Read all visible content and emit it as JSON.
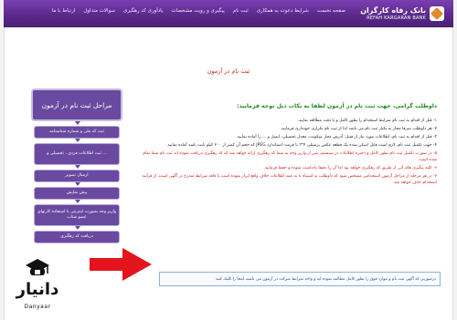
{
  "header": {
    "logo_fa": "بانک رفاه کارگران",
    "logo_en": "REFAH KARGARAN BANK",
    "nav": [
      "صفحه نخست",
      "شرایط دعوت به همکاری",
      "ثبت نام",
      "پیگیری و رویت مشخصات",
      "یادآوری کد رهگیری",
      "سوالات متداول",
      "ارتباط با ما"
    ]
  },
  "page_title": "ثبت نام در آزمون",
  "sidebar": {
    "heading": "مراحل ثبت نام در آزمون",
    "steps": [
      "ثبت کد ملی و شماره شناسنامه",
      "ثبت اطلاعات فردی ، تحصیلی و ...",
      "ارسال تصویر",
      "پیش نمایش",
      "واریز وجه بصورت اینترنتی با استفاده کارتهای عضو شتاب",
      "دریافت کد رهگیری"
    ]
  },
  "content": {
    "intro": "داوطلب گرامی، جهت ثبت نام در آزمون لطفا به نکات ذیل توجه فرمایید:",
    "rules": [
      {
        "text": "۱- قبل از اقدام به ثبت نام شرایط استخدام را بطور کامل و با دقت مطالعه نمایید.",
        "red": false
      },
      {
        "text": "۲- هر داوطلب صرفا مجاز به یکبار ثبت نام می باشد لذا از ثبت نام تکراری خودداری فرمایید.",
        "red": false
      },
      {
        "text": "۳- قبل از اقدام به ثبت نام، اطلاعات مورد نیاز از قبیل: آدرس محل سکونت، معدل تحصیلی، ایمیل و ... را آماده نمایید.",
        "red": false
      },
      {
        "text": "۴- جهت تکمیل ثبت نام، لازم است فایل اسکن شده یک قطعه عکس پرسنلی ۴*۳ با فرمت استاندارد JPEG که حجم آن کمتر از ۲۰۰ کیلو بایت باشد آماده نمایید.",
        "red": false
      },
      {
        "text": "۵- در صورت تکمیل ثبت نام بطور کامل و ذخیره اطلاعات در سیستم، پس از واریز وجه به شما کد رهگیری ارائه خواهد شد که کد رهگیری دریافت نموده اید ثبت نام شما تمام شده است.",
        "red": true
      },
      {
        "text": "۶- کلیه پیگیری های آتی از طریق کد رهگیری خواهد بود لذا آن را دقیقا یادداشت نموده و حفظ فرمایید.",
        "red": true
      },
      {
        "text": "۷- در هر مرحله از مراحل آزمون استخدامی مشخص شود که داوطلب به اشتباه یا به عمد اطلاعات خلاف واقع ابراز نموده است یا فاقد شرایط مندرج در آگهی است، از فرآیند استخدام حذف خواهد شد.",
        "red": true
      }
    ]
  },
  "notice": "درصورتی که آگهی ثبت نام و موارد فوق را بطور کامل مطالعه نموده اید و واجد شرایط شرکت در آزمون می باشید اینجا را کلیک کنید",
  "watermark": {
    "fa": "دانیار",
    "en": "Danyaar"
  }
}
